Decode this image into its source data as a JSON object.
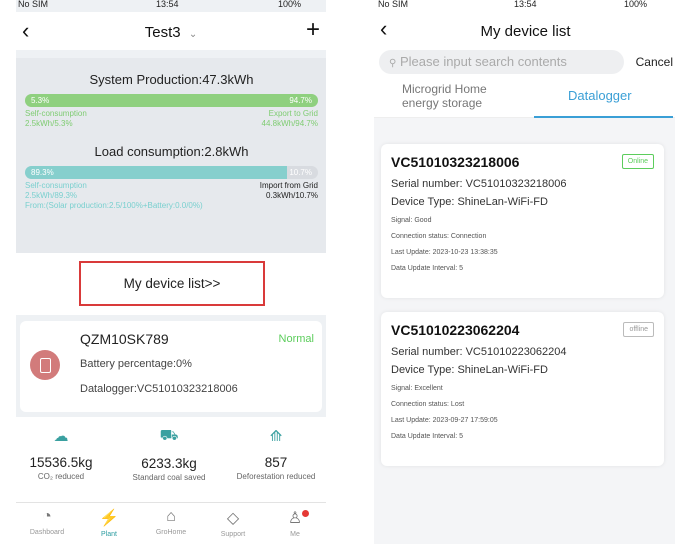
{
  "left": {
    "status": {
      "carrier": "No SIM",
      "time": "13:54",
      "battery": "100%"
    },
    "nav": {
      "title": "Test3",
      "caret": "⌄",
      "plus": "+"
    },
    "production": {
      "title": "System Production:47.3kWh",
      "bar_left": "5.3%",
      "bar_right": "94.7%",
      "fill_fraction": 0.053,
      "left_label": "Self-consumption",
      "right_label": "Export to Grid",
      "left_value": "2.5kWh/5.3%",
      "right_value": "44.8kWh/94.7%"
    },
    "load": {
      "title": "Load consumption:2.8kWh",
      "bar_left": "89.3%",
      "bar_right": "10.7%",
      "fill_fraction": 0.893,
      "left_label": "Self-consumption",
      "right_label": "Import from Grid",
      "left_value": "2.5kWh/89.3%",
      "right_value": "0.3kWh/10.7%",
      "from": "From:(Solar production:2.5/100%+Battery:0.0/0%)"
    },
    "device_link": "My device list>>",
    "device": {
      "name": "QZM10SK789",
      "state": "Normal",
      "battery": "Battery percentage:0%",
      "datalogger": "Datalogger:VC51010323218006"
    },
    "stats": [
      {
        "value": "15536.5kg",
        "label": "CO₂ reduced",
        "icon": "cloud-icon"
      },
      {
        "value": "6233.3kg",
        "label": "Standard coal saved",
        "icon": "cart-icon"
      },
      {
        "value": "857",
        "label": "Deforestation reduced",
        "icon": "tree-icon"
      }
    ],
    "tabbar": [
      {
        "label": "Dashboard",
        "icon": "dashboard-icon"
      },
      {
        "label": "Plant",
        "icon": "plant-icon"
      },
      {
        "label": "GroHome",
        "icon": "home-icon"
      },
      {
        "label": "Support",
        "icon": "support-icon"
      },
      {
        "label": "Me",
        "icon": "user-icon"
      }
    ]
  },
  "right": {
    "status": {
      "carrier": "No SIM",
      "time": "13:54",
      "battery": "100%"
    },
    "nav": {
      "title": "My device list"
    },
    "search": {
      "placeholder": "Please input search contents",
      "cancel": "Cancel"
    },
    "tabs": {
      "tab1": "Microgrid Home energy storage",
      "tab2": "Datalogger"
    },
    "devices": [
      {
        "id": "VC51010323218006",
        "status": "Online",
        "serial": "Serial number: VC51010323218006",
        "type": "Device Type: ShineLan-WiFi-FD",
        "signal": "Signal: Good",
        "connection": "Connection status: Connection",
        "update": "Last Update: 2023-10-23 13:38:35",
        "interval": "Data Update Interval: 5"
      },
      {
        "id": "VC51010223062204",
        "status": "offline",
        "serial": "Serial number: VC51010223062204",
        "type": "Device Type: ShineLan-WiFi-FD",
        "signal": "Signal: Excellent",
        "connection": "Connection status: Lost",
        "update": "Last Update: 2023-09-27 17:59:05",
        "interval": "Data Update Interval: 5"
      }
    ]
  },
  "colors": {
    "green": "#7fcc72",
    "teal": "#7ad0cf",
    "highlight": "#d93a3a",
    "accent_blue": "#3a9fd6",
    "online": "#5ccd5c"
  }
}
